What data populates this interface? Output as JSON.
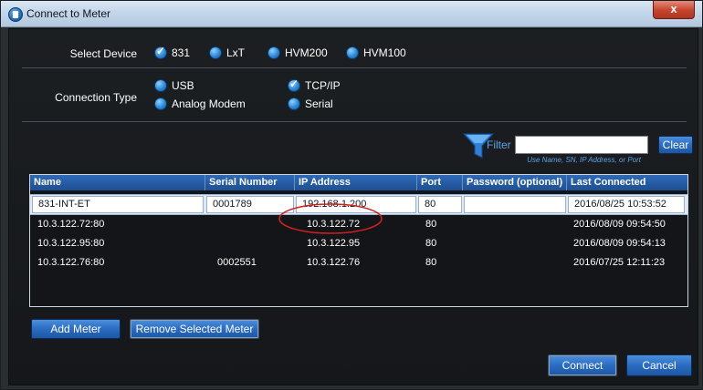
{
  "window": {
    "title": "Connect to Meter",
    "close_label": "x"
  },
  "select_device": {
    "label": "Select Device",
    "options": [
      {
        "label": "831",
        "checked": true
      },
      {
        "label": "LxT",
        "checked": false
      },
      {
        "label": "HVM200",
        "checked": false
      },
      {
        "label": "HVM100",
        "checked": false
      }
    ]
  },
  "connection_type": {
    "label": "Connection Type",
    "options": [
      {
        "label": "USB",
        "checked": false
      },
      {
        "label": "Analog Modem",
        "checked": false
      },
      {
        "label": "TCP/IP",
        "checked": true
      },
      {
        "label": "Serial",
        "checked": false
      }
    ]
  },
  "filter": {
    "label": "Filter",
    "value": "",
    "hint": "Use Name, SN, IP Address, or Port",
    "clear_label": "Clear"
  },
  "table": {
    "columns": [
      "Name",
      "Serial Number",
      "IP Address",
      "Port",
      "Password (optional)",
      "Last Connected"
    ],
    "rows": [
      {
        "name": "831-INT-ET",
        "serial": "0001789",
        "ip": "192.168.1.200",
        "port": "80",
        "password": "",
        "last": "2016/08/25  10:53:52",
        "selected": true
      },
      {
        "name": "10.3.122.72:80",
        "serial": "",
        "ip": "10.3.122.72",
        "port": "80",
        "password": "",
        "last": "2016/08/09  09:54:50",
        "selected": false
      },
      {
        "name": "10.3.122.95:80",
        "serial": "",
        "ip": "10.3.122.95",
        "port": "80",
        "password": "",
        "last": "2016/08/09  09:54:13",
        "selected": false
      },
      {
        "name": "10.3.122.76:80",
        "serial": "0002551",
        "ip": "10.3.122.76",
        "port": "80",
        "password": "",
        "last": "2016/07/25  12:11:23",
        "selected": false
      }
    ]
  },
  "buttons": {
    "add_meter": "Add Meter",
    "remove_meter": "Remove Selected Meter",
    "connect": "Connect",
    "cancel": "Cancel"
  },
  "colors": {
    "accent_blue": "#2a6cc2",
    "annotation_red": "#d42020",
    "header_blue": "#1e4f92"
  }
}
